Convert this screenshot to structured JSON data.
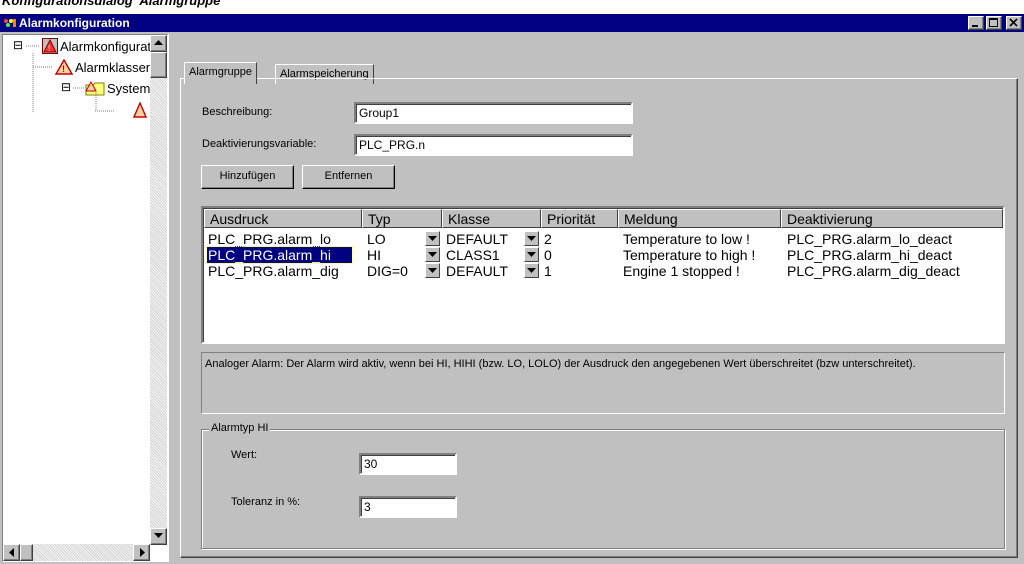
{
  "doc_caption": "Konfigurationsdialog 'Alarmgruppe'",
  "window": {
    "title": "Alarmkonfiguration",
    "controls": [
      "minimize-icon",
      "maximize-icon",
      "close-icon"
    ]
  },
  "tree": {
    "items": [
      {
        "label": "Alarmkonfiguration",
        "icon": "alarm-config-icon",
        "expander": "⊟"
      },
      {
        "label": "Alarmklassen",
        "icon": "alarm-class-icon"
      },
      {
        "label": "System",
        "icon": "folder-alarm-icon",
        "expander": "⊟"
      },
      {
        "label": "",
        "icon": "alarm-group-icon"
      }
    ]
  },
  "tabs": [
    {
      "label": "Alarmgruppe",
      "active": true
    },
    {
      "label": "Alarmspeicherung",
      "active": false
    }
  ],
  "form": {
    "beschreibung_label": "Beschreibung:",
    "beschreibung_value": "Group1",
    "deaktivierung_label": "Deaktivierungsvariable:",
    "deaktivierung_value": "PLC_PRG.n"
  },
  "buttons": {
    "add": "Hinzufügen",
    "remove": "Entfernen"
  },
  "table": {
    "columns": [
      "Ausdruck",
      "Typ",
      "Klasse",
      "Priorität",
      "Meldung",
      "Deaktivierung"
    ],
    "rows": [
      {
        "ausdruck": "PLC_PRG.alarm_lo",
        "typ": "LO",
        "klasse": "DEFAULT",
        "prioritaet": "2",
        "meldung": "Temperature to low !",
        "deaktivierung": "PLC_PRG.alarm_lo_deact",
        "selected": false
      },
      {
        "ausdruck": "PLC_PRG.alarm_hi",
        "typ": "HI",
        "klasse": "CLASS1",
        "prioritaet": "0",
        "meldung": "Temperature to high !",
        "deaktivierung": "PLC_PRG.alarm_hi_deact",
        "selected": true
      },
      {
        "ausdruck": "PLC_PRG.alarm_dig",
        "typ": "DIG=0",
        "klasse": "DEFAULT",
        "prioritaet": "1",
        "meldung": "Engine 1 stopped !",
        "deaktivierung": "PLC_PRG.alarm_dig_deact",
        "selected": false
      }
    ]
  },
  "description": "Analoger Alarm: Der Alarm wird aktiv, wenn bei HI, HIHI (bzw. LO, LOLO) der Ausdruck den angegebenen Wert überschreitet (bzw unterschreitet).",
  "alarmtyp": {
    "legend": "Alarmtyp HI",
    "wert_label": "Wert:",
    "wert_value": "30",
    "toleranz_label": "Toleranz in %:",
    "toleranz_value": "3"
  },
  "colors": {
    "titlebar": "#000080",
    "face": "#c0c0c0",
    "selection": "#000080"
  }
}
